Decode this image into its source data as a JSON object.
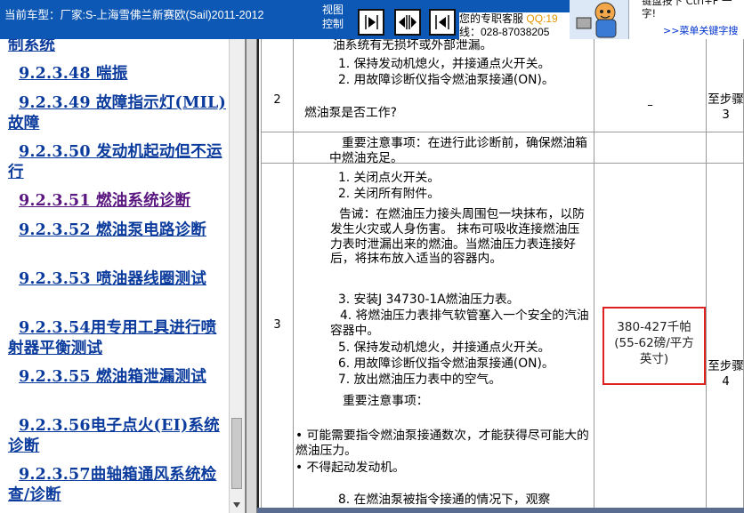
{
  "header": {
    "car_label": "当前车型：厂家:S-上海雪佛兰新赛欧(Sail)2011-2012",
    "view_control_line1": "视图",
    "view_control_line2": "控制",
    "service_line1": "您的专职客服",
    "service_qq": "QQ:19",
    "service_line2": "线：028-87038205",
    "hint_top": "键盘按下  Ctrl+F  一",
    "hint_top2": "字!",
    "hint_link": ">>菜单关键字搜"
  },
  "sidebar": {
    "items": [
      {
        "label": "制系统"
      },
      {
        "label": "9.2.3.48 喘振"
      },
      {
        "label": "9.2.3.49 故障指示灯(MIL)故障"
      },
      {
        "label": "9.2.3.50 发动机起动但不运行"
      },
      {
        "label": "9.2.3.51 燃油系统诊断"
      },
      {
        "label": "9.2.3.52 燃油泵电路诊断"
      },
      {
        "label": "9.2.3.53 喷油器线圈测试"
      },
      {
        "label": "9.2.3.54用专用工具进行喷射器平衡测试"
      },
      {
        "label": "9.2.3.55 燃油箱泄漏测试"
      },
      {
        "label": "9.2.3.56电子点火(EI)系统诊断"
      },
      {
        "label": "9.2.3.57曲轴箱通风系统检查/诊断"
      }
    ]
  },
  "table": {
    "row2": {
      "num": "2",
      "line0": "油系统有无损坏或外部泄漏。",
      "step1": "1.  保持发动机熄火，并接通点火开关。",
      "step2": "2.  用故障诊断仪指令燃油泵接通(ON)。",
      "question": "燃油泵是否工作?",
      "value": "–",
      "next": "至步骤3"
    },
    "row3": {
      "num": "3",
      "note1": "重要注意事项：在进行此诊断前，确保燃油箱中燃油充足。",
      "step1": "1.  关闭点火开关。",
      "step2": "2.  关闭所有附件。",
      "warning": "告诫：在燃油压力接头周围包一块抹布，以防发生火灾或人身伤害。 抹布可吸收连接燃油压力表时泄漏出来的燃油。当燃油压力表连接好后，将抹布放入适当的容器内。",
      "step3": "3.  安装J 34730-1A燃油压力表。",
      "step4": "4.  将燃油压力表排气软管塞入一个安全的汽油容器中。",
      "step5": "5.  保持发动机熄火，并接通点火开关。",
      "step6": "6.  用故障诊断仪指令燃油泵接通(ON)。",
      "step7": "7.  放出燃油压力表中的空气。",
      "note2": "重要注意事项：",
      "bullet1": "•  可能需要指令燃油泵接通数次，才能获得尽可能大的燃油压力。",
      "bullet2": "•  不得起动发动机。",
      "step8": "8.  在燃油泵被指令接通的情况下，观察",
      "value_line1": "380-427千帕",
      "value_line2": "(55-62磅/平方",
      "value_line3": "英寸)",
      "next": "至步骤4"
    }
  }
}
